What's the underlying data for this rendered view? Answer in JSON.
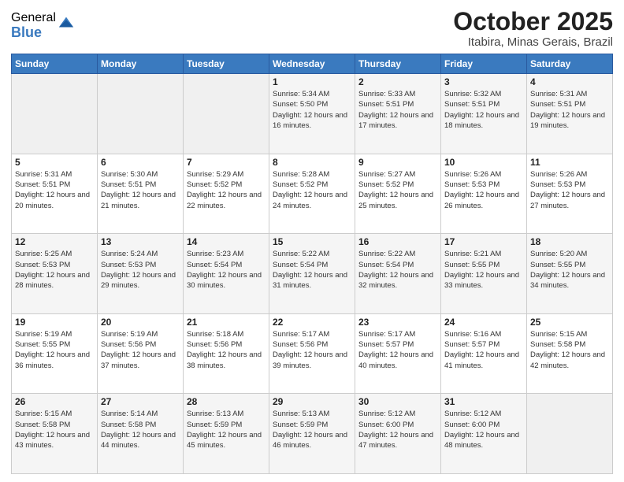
{
  "logo": {
    "general": "General",
    "blue": "Blue"
  },
  "header": {
    "month": "October 2025",
    "location": "Itabira, Minas Gerais, Brazil"
  },
  "days_header": [
    "Sunday",
    "Monday",
    "Tuesday",
    "Wednesday",
    "Thursday",
    "Friday",
    "Saturday"
  ],
  "weeks": [
    [
      {
        "day": "",
        "sunrise": "",
        "sunset": "",
        "daylight": ""
      },
      {
        "day": "",
        "sunrise": "",
        "sunset": "",
        "daylight": ""
      },
      {
        "day": "",
        "sunrise": "",
        "sunset": "",
        "daylight": ""
      },
      {
        "day": "1",
        "sunrise": "Sunrise: 5:34 AM",
        "sunset": "Sunset: 5:50 PM",
        "daylight": "Daylight: 12 hours and 16 minutes."
      },
      {
        "day": "2",
        "sunrise": "Sunrise: 5:33 AM",
        "sunset": "Sunset: 5:51 PM",
        "daylight": "Daylight: 12 hours and 17 minutes."
      },
      {
        "day": "3",
        "sunrise": "Sunrise: 5:32 AM",
        "sunset": "Sunset: 5:51 PM",
        "daylight": "Daylight: 12 hours and 18 minutes."
      },
      {
        "day": "4",
        "sunrise": "Sunrise: 5:31 AM",
        "sunset": "Sunset: 5:51 PM",
        "daylight": "Daylight: 12 hours and 19 minutes."
      }
    ],
    [
      {
        "day": "5",
        "sunrise": "Sunrise: 5:31 AM",
        "sunset": "Sunset: 5:51 PM",
        "daylight": "Daylight: 12 hours and 20 minutes."
      },
      {
        "day": "6",
        "sunrise": "Sunrise: 5:30 AM",
        "sunset": "Sunset: 5:51 PM",
        "daylight": "Daylight: 12 hours and 21 minutes."
      },
      {
        "day": "7",
        "sunrise": "Sunrise: 5:29 AM",
        "sunset": "Sunset: 5:52 PM",
        "daylight": "Daylight: 12 hours and 22 minutes."
      },
      {
        "day": "8",
        "sunrise": "Sunrise: 5:28 AM",
        "sunset": "Sunset: 5:52 PM",
        "daylight": "Daylight: 12 hours and 24 minutes."
      },
      {
        "day": "9",
        "sunrise": "Sunrise: 5:27 AM",
        "sunset": "Sunset: 5:52 PM",
        "daylight": "Daylight: 12 hours and 25 minutes."
      },
      {
        "day": "10",
        "sunrise": "Sunrise: 5:26 AM",
        "sunset": "Sunset: 5:53 PM",
        "daylight": "Daylight: 12 hours and 26 minutes."
      },
      {
        "day": "11",
        "sunrise": "Sunrise: 5:26 AM",
        "sunset": "Sunset: 5:53 PM",
        "daylight": "Daylight: 12 hours and 27 minutes."
      }
    ],
    [
      {
        "day": "12",
        "sunrise": "Sunrise: 5:25 AM",
        "sunset": "Sunset: 5:53 PM",
        "daylight": "Daylight: 12 hours and 28 minutes."
      },
      {
        "day": "13",
        "sunrise": "Sunrise: 5:24 AM",
        "sunset": "Sunset: 5:53 PM",
        "daylight": "Daylight: 12 hours and 29 minutes."
      },
      {
        "day": "14",
        "sunrise": "Sunrise: 5:23 AM",
        "sunset": "Sunset: 5:54 PM",
        "daylight": "Daylight: 12 hours and 30 minutes."
      },
      {
        "day": "15",
        "sunrise": "Sunrise: 5:22 AM",
        "sunset": "Sunset: 5:54 PM",
        "daylight": "Daylight: 12 hours and 31 minutes."
      },
      {
        "day": "16",
        "sunrise": "Sunrise: 5:22 AM",
        "sunset": "Sunset: 5:54 PM",
        "daylight": "Daylight: 12 hours and 32 minutes."
      },
      {
        "day": "17",
        "sunrise": "Sunrise: 5:21 AM",
        "sunset": "Sunset: 5:55 PM",
        "daylight": "Daylight: 12 hours and 33 minutes."
      },
      {
        "day": "18",
        "sunrise": "Sunrise: 5:20 AM",
        "sunset": "Sunset: 5:55 PM",
        "daylight": "Daylight: 12 hours and 34 minutes."
      }
    ],
    [
      {
        "day": "19",
        "sunrise": "Sunrise: 5:19 AM",
        "sunset": "Sunset: 5:55 PM",
        "daylight": "Daylight: 12 hours and 36 minutes."
      },
      {
        "day": "20",
        "sunrise": "Sunrise: 5:19 AM",
        "sunset": "Sunset: 5:56 PM",
        "daylight": "Daylight: 12 hours and 37 minutes."
      },
      {
        "day": "21",
        "sunrise": "Sunrise: 5:18 AM",
        "sunset": "Sunset: 5:56 PM",
        "daylight": "Daylight: 12 hours and 38 minutes."
      },
      {
        "day": "22",
        "sunrise": "Sunrise: 5:17 AM",
        "sunset": "Sunset: 5:56 PM",
        "daylight": "Daylight: 12 hours and 39 minutes."
      },
      {
        "day": "23",
        "sunrise": "Sunrise: 5:17 AM",
        "sunset": "Sunset: 5:57 PM",
        "daylight": "Daylight: 12 hours and 40 minutes."
      },
      {
        "day": "24",
        "sunrise": "Sunrise: 5:16 AM",
        "sunset": "Sunset: 5:57 PM",
        "daylight": "Daylight: 12 hours and 41 minutes."
      },
      {
        "day": "25",
        "sunrise": "Sunrise: 5:15 AM",
        "sunset": "Sunset: 5:58 PM",
        "daylight": "Daylight: 12 hours and 42 minutes."
      }
    ],
    [
      {
        "day": "26",
        "sunrise": "Sunrise: 5:15 AM",
        "sunset": "Sunset: 5:58 PM",
        "daylight": "Daylight: 12 hours and 43 minutes."
      },
      {
        "day": "27",
        "sunrise": "Sunrise: 5:14 AM",
        "sunset": "Sunset: 5:58 PM",
        "daylight": "Daylight: 12 hours and 44 minutes."
      },
      {
        "day": "28",
        "sunrise": "Sunrise: 5:13 AM",
        "sunset": "Sunset: 5:59 PM",
        "daylight": "Daylight: 12 hours and 45 minutes."
      },
      {
        "day": "29",
        "sunrise": "Sunrise: 5:13 AM",
        "sunset": "Sunset: 5:59 PM",
        "daylight": "Daylight: 12 hours and 46 minutes."
      },
      {
        "day": "30",
        "sunrise": "Sunrise: 5:12 AM",
        "sunset": "Sunset: 6:00 PM",
        "daylight": "Daylight: 12 hours and 47 minutes."
      },
      {
        "day": "31",
        "sunrise": "Sunrise: 5:12 AM",
        "sunset": "Sunset: 6:00 PM",
        "daylight": "Daylight: 12 hours and 48 minutes."
      },
      {
        "day": "",
        "sunrise": "",
        "sunset": "",
        "daylight": ""
      }
    ]
  ]
}
